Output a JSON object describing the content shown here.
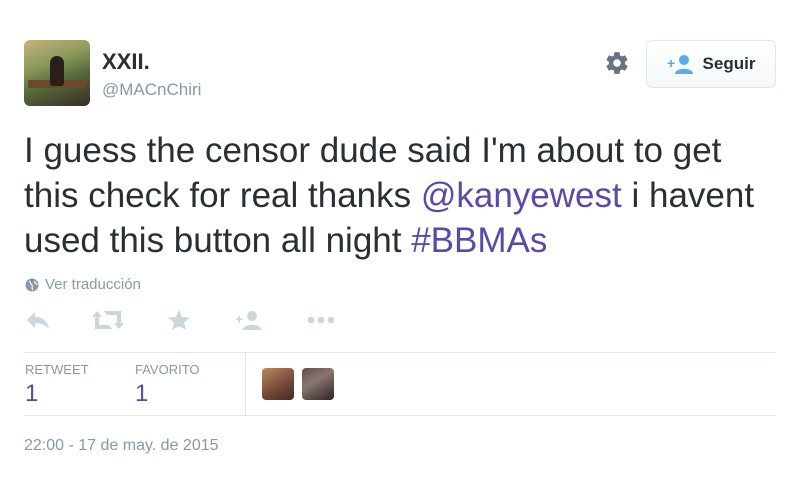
{
  "user": {
    "display_name": "XXII.",
    "handle": "@MACnChiri"
  },
  "header": {
    "follow_label": "Seguir",
    "settings_icon": "gear-icon",
    "follow_icon": "add-user-icon"
  },
  "tweet": {
    "text_part1": "I guess the censor dude said I'm about to get this check for real thanks ",
    "mention": "@kanyewest",
    "text_part2": " i havent used this button all night ",
    "hashtag": "#BBMAs",
    "translate_label": "Ver traducción",
    "translate_icon": "globe-icon"
  },
  "actions": {
    "icons": [
      "reply-icon",
      "retweet-icon",
      "favorite-icon",
      "follow-icon",
      "more-icon"
    ]
  },
  "stats": {
    "retweet_label": "RETWEET",
    "retweet_count": "1",
    "favorite_label": "FAVORITO",
    "favorite_count": "1"
  },
  "timestamp": "22:00 - 17 de may. de 2015",
  "colors": {
    "link": "#5b4aa5",
    "muted": "#8899a6",
    "text": "#292f33",
    "border": "#e1e8ed"
  }
}
